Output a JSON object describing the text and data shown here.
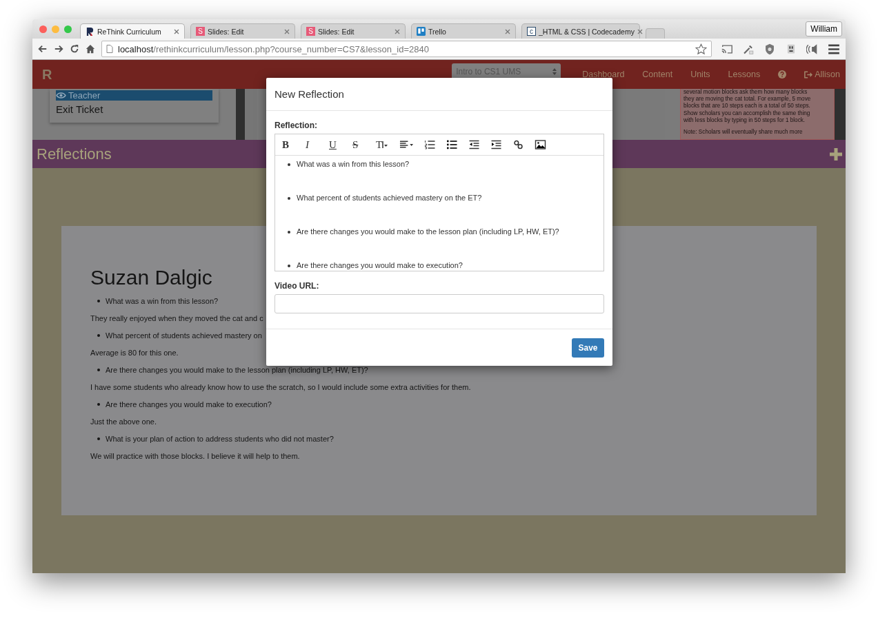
{
  "browser": {
    "tabs": [
      {
        "title": "ReThink Curriculum",
        "kind": "rethink",
        "selected": true
      },
      {
        "title": "Slides: Edit",
        "kind": "slides",
        "badge": "S",
        "selected": false
      },
      {
        "title": "Slides: Edit",
        "kind": "slides",
        "badge": "S",
        "selected": false
      },
      {
        "title": "Trello",
        "kind": "trello",
        "selected": false
      },
      {
        "title": "_HTML & CSS | Codecademy",
        "kind": "codecademy",
        "badge": "c",
        "selected": false
      }
    ],
    "profile": "William",
    "url": {
      "host": "localhost",
      "path": "/rethinkcurriculum/lesson.php?course_number=CS7&lesson_id=2840"
    }
  },
  "header": {
    "logo": "R",
    "course_select": "Intro to CS1 UMS",
    "nav": [
      {
        "label": "Dashboard",
        "kind": "link"
      },
      {
        "label": "Content",
        "kind": "link"
      },
      {
        "label": "Units",
        "kind": "link"
      },
      {
        "label": "Lessons",
        "kind": "link"
      },
      {
        "kind": "help"
      },
      {
        "label": "Allison",
        "kind": "logout"
      }
    ]
  },
  "sidebar": {
    "items": [
      {
        "label": "Teacher",
        "kind": "view",
        "selected": true
      },
      {
        "label": "Exit Ticket",
        "kind": "link",
        "selected": false
      }
    ]
  },
  "note": {
    "paragraphs": [
      [
        "several motion blocks ask them how many blocks",
        "they are moving the cat total. For example, 5 move",
        "blocks that are 10 steps each is a total of 50 steps.",
        "Show scholars you can accomplish the same thing",
        "with less blocks by typing in 50 steps for 1 block."
      ],
      [
        "Note: Scholars will eventually share much more"
      ]
    ]
  },
  "section": {
    "title": "Reflections"
  },
  "reflection": {
    "author": "Suzan Dalgic",
    "entries": [
      {
        "kind": "question",
        "text": "What was a win from this lesson?"
      },
      {
        "kind": "answer",
        "text": "They really enjoyed when they moved the cat and c"
      },
      {
        "kind": "question",
        "text": "What percent of students achieved mastery on"
      },
      {
        "kind": "answer",
        "text": "Average is 80 for this one."
      },
      {
        "kind": "question",
        "text": "Are there changes you would make to the lesson plan (including LP, HW, ET)?"
      },
      {
        "kind": "answer",
        "text": "I have some students who already know how to use the scratch, so I would include some extra activities for them."
      },
      {
        "kind": "question",
        "text": "Are there changes you would make to execution?"
      },
      {
        "kind": "answer",
        "text": "Just the above one."
      },
      {
        "kind": "question",
        "text": "What is your plan of action to address students who did not master?"
      },
      {
        "kind": "answer",
        "text": "We will practice with those blocks. I believe it will help to them."
      }
    ]
  },
  "modal": {
    "title": "New Reflection",
    "reflection_label": "Reflection:",
    "toolbar": [
      {
        "kind": "bold",
        "label": "B"
      },
      {
        "kind": "italic",
        "label": "I"
      },
      {
        "kind": "underline",
        "label": "U"
      },
      {
        "kind": "strike",
        "label": "S"
      },
      {
        "kind": "fontsize",
        "label": "T"
      },
      {
        "kind": "align"
      },
      {
        "kind": "ordered"
      },
      {
        "kind": "bullets"
      },
      {
        "kind": "outdent"
      },
      {
        "kind": "indent"
      },
      {
        "kind": "link"
      },
      {
        "kind": "image"
      }
    ],
    "editor_items": [
      "What was a win from this lesson?",
      "What percent of students achieved mastery on the ET?",
      "Are there changes you would make to the lesson plan (including LP, HW, ET)?",
      "Are there changes you would make to execution?"
    ],
    "video_label": "Video URL:",
    "save": "Save"
  }
}
